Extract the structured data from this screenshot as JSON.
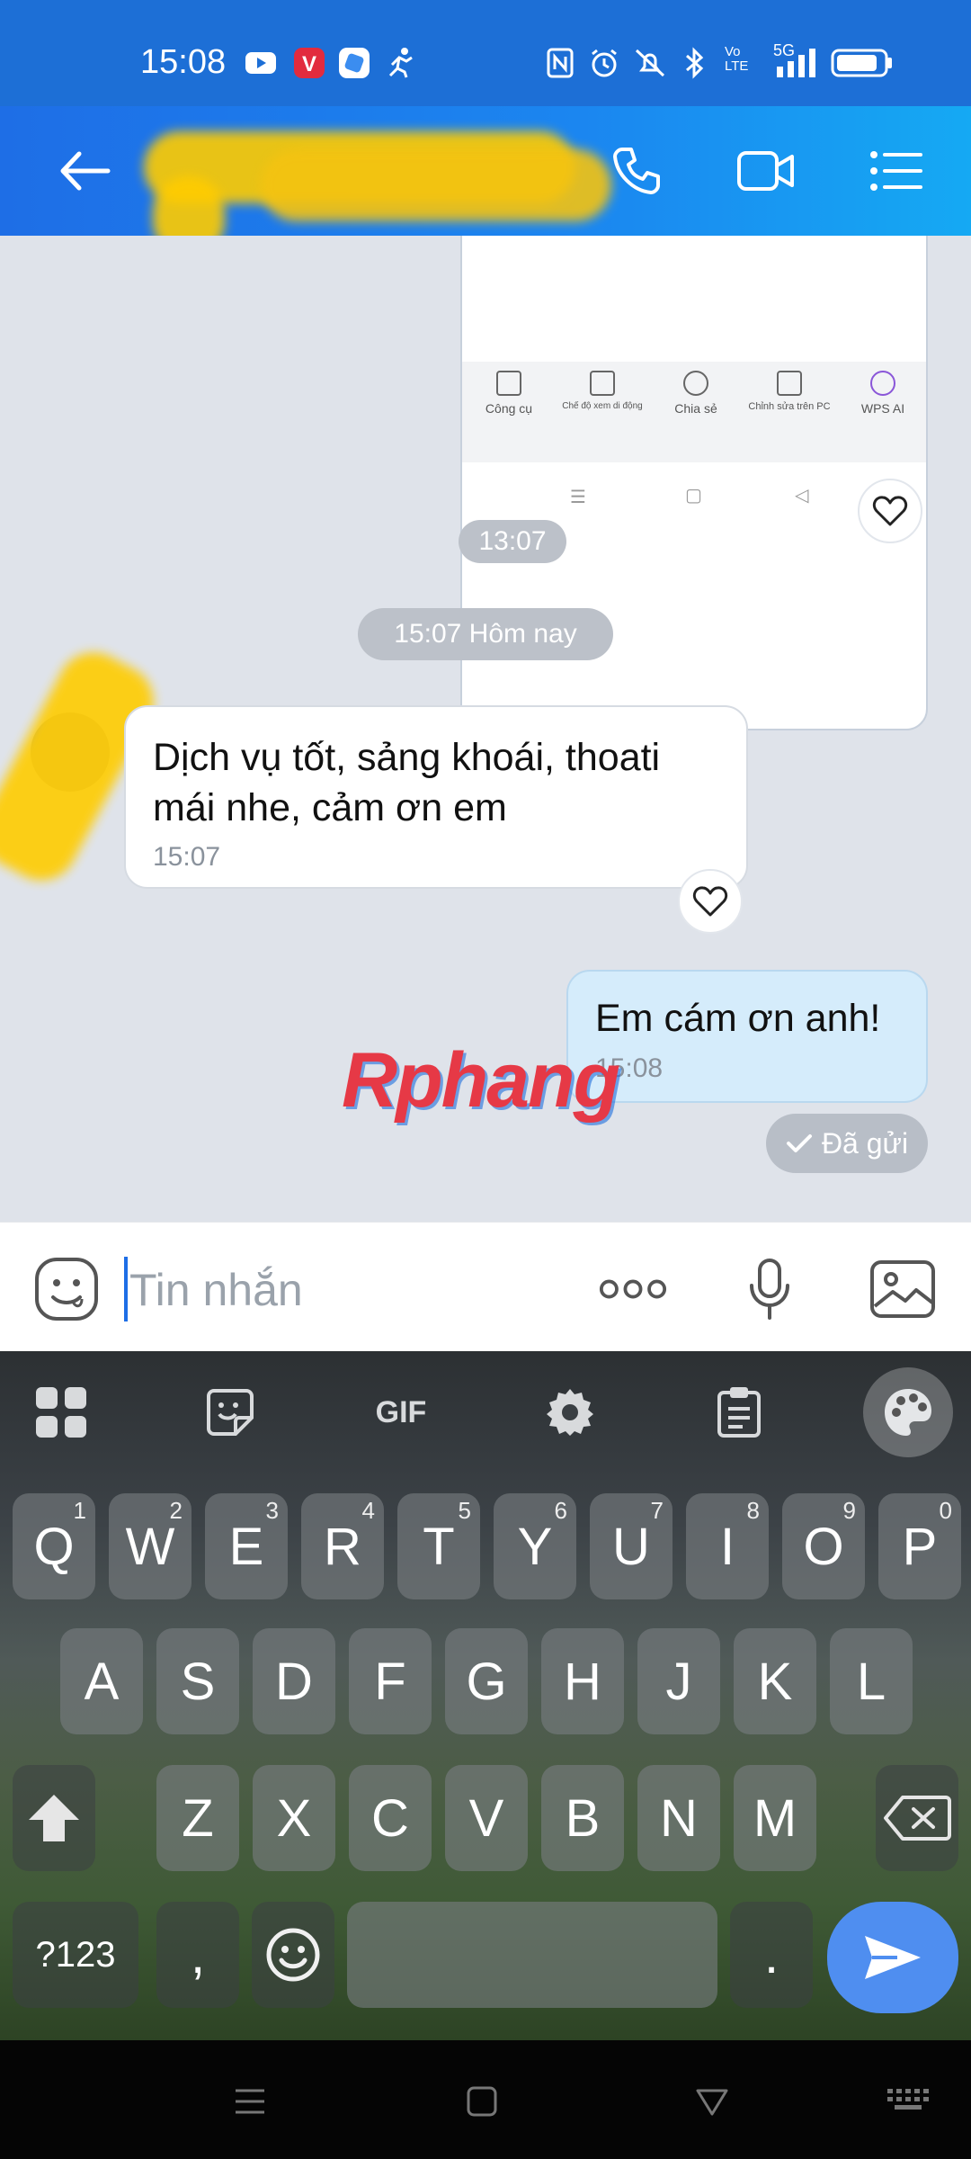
{
  "status_bar": {
    "time": "15:08",
    "network": "5G",
    "volte": "Vo LTE"
  },
  "header": {
    "contact_name_redacted": ""
  },
  "shared_screenshot": {
    "tools": [
      "Công cụ",
      "Chế độ xem di động",
      "Chia sẻ",
      "Chỉnh sửa trên PC",
      "WPS AI"
    ]
  },
  "chat": {
    "time_divider_1": "13:07",
    "time_divider_2": "15:07 Hôm nay",
    "incoming": {
      "text": "Dịch vụ tốt, sảng khoái, thoati mái nhe, cảm ơn em",
      "time": "15:07"
    },
    "outgoing": {
      "text": "Em cám ơn anh!",
      "time": "15:08",
      "status": "Đã gửi"
    },
    "watermark": "Rphang"
  },
  "input": {
    "placeholder": "Tin nhắn"
  },
  "keyboard": {
    "toolbar": [
      "apps",
      "sticker",
      "GIF",
      "settings",
      "clipboard",
      "theme"
    ],
    "gif_label": "GIF",
    "row1": [
      {
        "k": "Q",
        "h": "1"
      },
      {
        "k": "W",
        "h": "2"
      },
      {
        "k": "E",
        "h": "3"
      },
      {
        "k": "R",
        "h": "4"
      },
      {
        "k": "T",
        "h": "5"
      },
      {
        "k": "Y",
        "h": "6"
      },
      {
        "k": "U",
        "h": "7"
      },
      {
        "k": "I",
        "h": "8"
      },
      {
        "k": "O",
        "h": "9"
      },
      {
        "k": "P",
        "h": "0"
      }
    ],
    "row2": [
      "A",
      "S",
      "D",
      "F",
      "G",
      "H",
      "J",
      "K",
      "L"
    ],
    "row3": [
      "Z",
      "X",
      "C",
      "V",
      "B",
      "N",
      "M"
    ],
    "symbols_label": "?123",
    "comma": ",",
    "period": "."
  },
  "colors": {
    "header_start": "#1e6ee6",
    "header_end": "#15a9f3",
    "outgoing_bubble": "#d5ecfb",
    "send_key": "#4f8ef0"
  }
}
